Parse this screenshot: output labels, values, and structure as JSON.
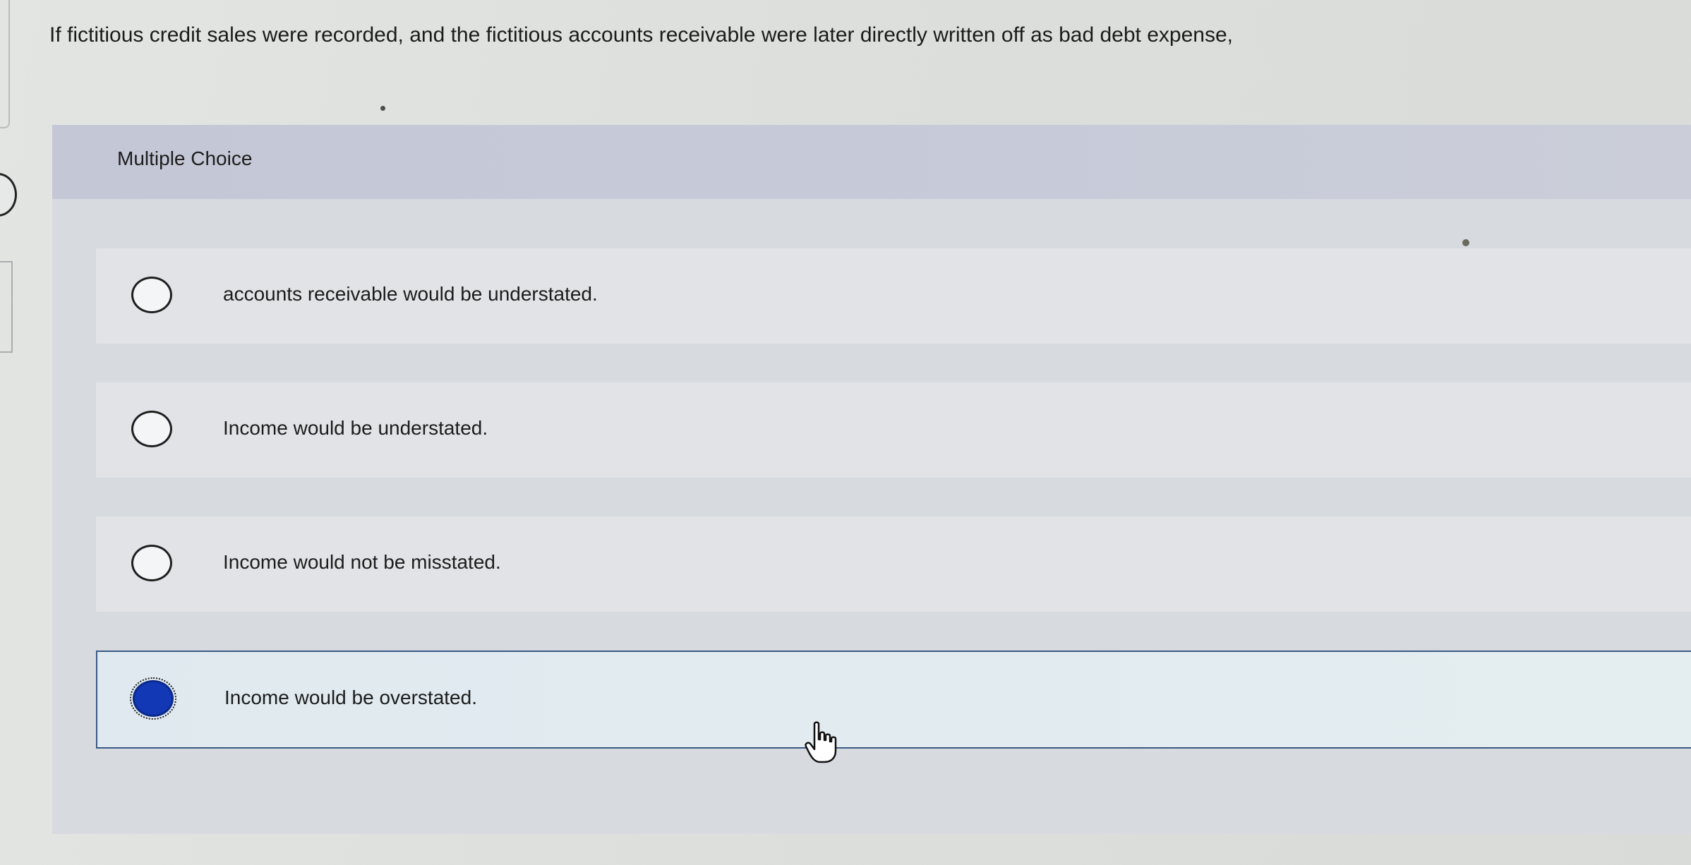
{
  "question": {
    "text": "If fictitious credit sales were recorded, and the fictitious accounts receivable were later directly written off as bad debt expense,"
  },
  "multiple_choice": {
    "title": "Multiple Choice",
    "options": [
      {
        "label": "accounts receivable would be understated.",
        "selected": false
      },
      {
        "label": "Income would be understated.",
        "selected": false
      },
      {
        "label": "Income would not be misstated.",
        "selected": false
      },
      {
        "label": "Income would be overstated.",
        "selected": true
      }
    ]
  },
  "colors": {
    "selected_radio": "#1238b5",
    "selected_border": "#3a5a85",
    "header_bg": "#c3c7d6"
  },
  "icons": {
    "cursor": "hand-pointer-icon"
  }
}
